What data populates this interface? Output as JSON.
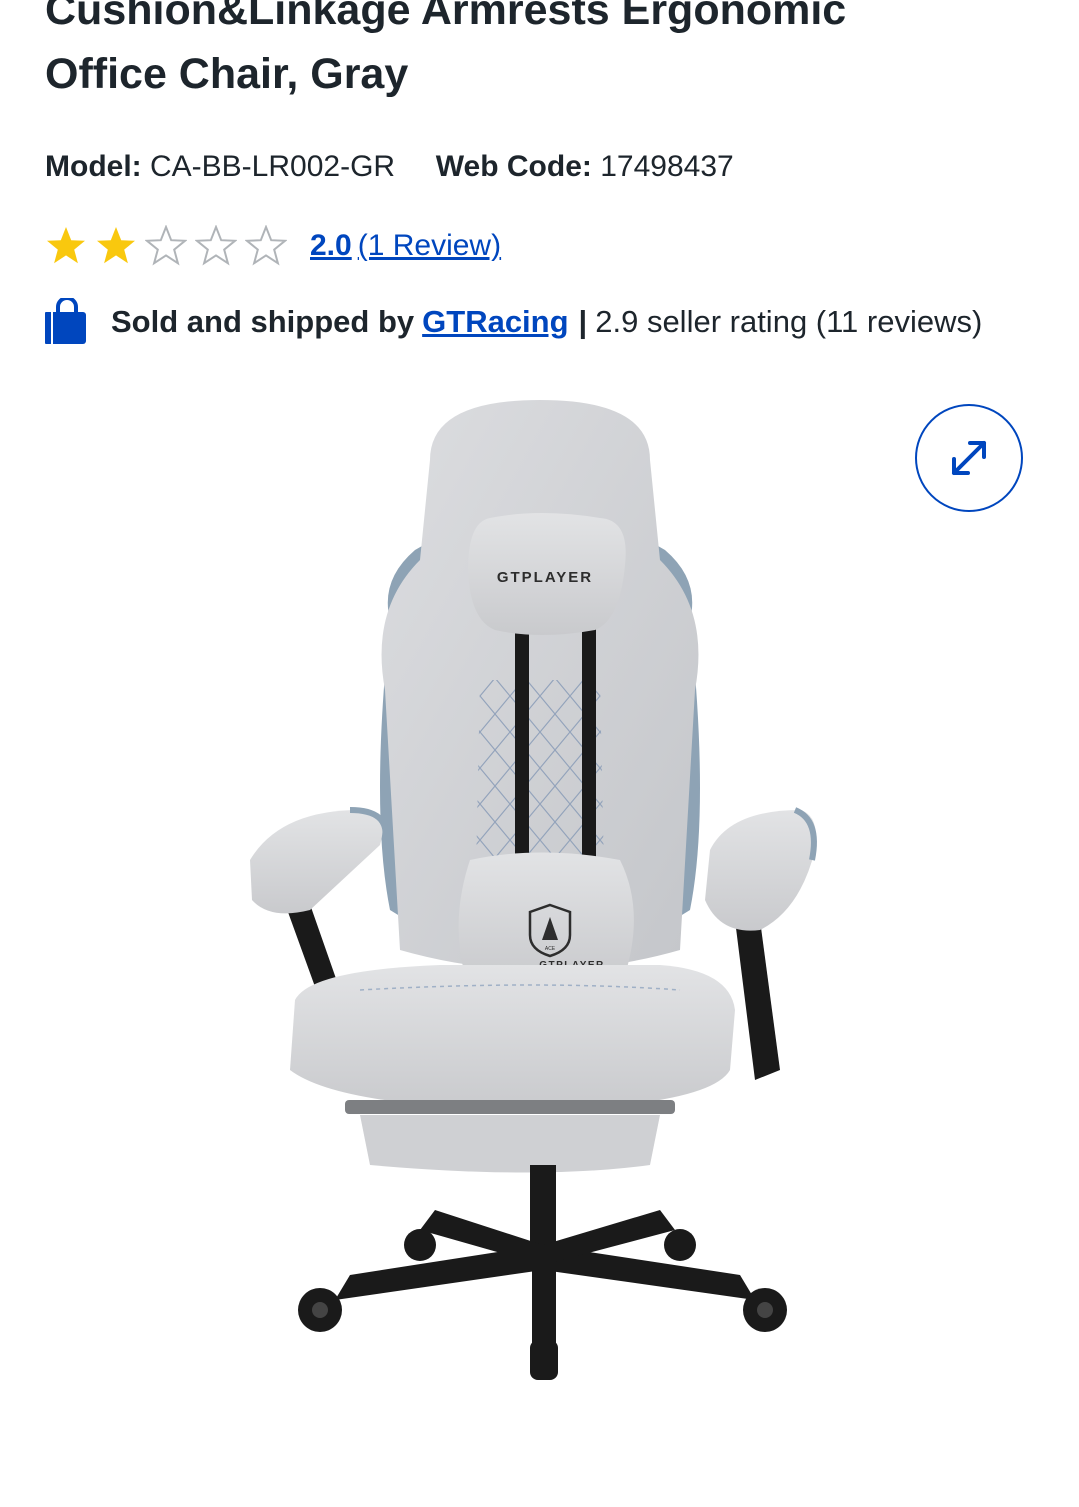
{
  "product": {
    "title_line1": "Cushion&Linkage Armrests Ergonomic",
    "title_line2": "Office Chair, Gray",
    "model_label": "Model:",
    "model_value": "CA-BB-LR002-GR",
    "webcode_label": "Web Code:",
    "webcode_value": "17498437"
  },
  "rating": {
    "stars_filled": 2,
    "stars_total": 5,
    "score": "2.0",
    "reviews_text": "(1 Review)",
    "star_color": "#f9c80e",
    "star_empty_color": "#b0b4b8"
  },
  "seller": {
    "icon": "shopping-bag-icon",
    "prefix": "Sold and shipped by",
    "name": "GTRacing",
    "separator": "|",
    "rating_text": "2.9 seller rating (11 reviews)"
  },
  "image": {
    "description_icon": "office-chair-image",
    "logo_text": "GTPLAYER",
    "badge_text": "ACE"
  },
  "controls": {
    "expand_icon": "expand-arrows-icon"
  },
  "colors": {
    "link": "#0046be",
    "text": "#1d252c"
  }
}
